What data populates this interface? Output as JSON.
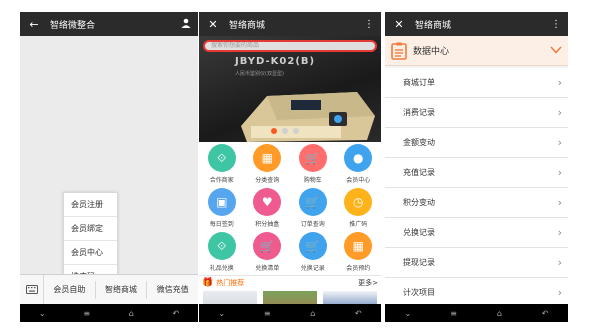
{
  "phone1": {
    "title": "智络微整合",
    "popup_items": [
      "会员注册",
      "会员绑定",
      "会员中心",
      "推广码"
    ],
    "menu_items": [
      "会员自助",
      "智络商城",
      "微信充值"
    ]
  },
  "phone2": {
    "title": "智络商城",
    "search_placeholder": "搜索你想要的商品",
    "banner_model": "JBYD-K02(B)",
    "banner_sub": "人民币鉴别仪(双显型)",
    "grid": [
      {
        "label": "合作商家",
        "color": "#3ec5a4",
        "icon": "share-icon"
      },
      {
        "label": "分类查询",
        "color": "#ff9b26",
        "icon": "grid-icon"
      },
      {
        "label": "购物车",
        "color": "#ff6d6d",
        "icon": "cart-icon"
      },
      {
        "label": "会员中心",
        "color": "#3fa3ee",
        "icon": "user-icon"
      },
      {
        "label": "每日签到",
        "color": "#56a6ef",
        "icon": "calendar-icon"
      },
      {
        "label": "积分抽盒",
        "color": "#ef5b8f",
        "icon": "heart-icon"
      },
      {
        "label": "订单查询",
        "color": "#3fa3ee",
        "icon": "cart-icon"
      },
      {
        "label": "推广码",
        "color": "#ffb31a",
        "icon": "clock-icon"
      },
      {
        "label": "礼品兑换",
        "color": "#3ec5a4",
        "icon": "share-icon"
      },
      {
        "label": "兑换清单",
        "color": "#ef5b8f",
        "icon": "cart-icon"
      },
      {
        "label": "兑换记录",
        "color": "#3fa3ee",
        "icon": "cart-icon"
      },
      {
        "label": "会员预约",
        "color": "#ff9b26",
        "icon": "grid-icon"
      }
    ],
    "hot_title": "热门推荐",
    "more": "更多>"
  },
  "phone3": {
    "title": "智络商城",
    "header_title": "数据中心",
    "rows": [
      "商城订单",
      "消费记录",
      "金额变动",
      "充值记录",
      "积分变动",
      "兑换记录",
      "提现记录",
      "计次项目"
    ]
  }
}
